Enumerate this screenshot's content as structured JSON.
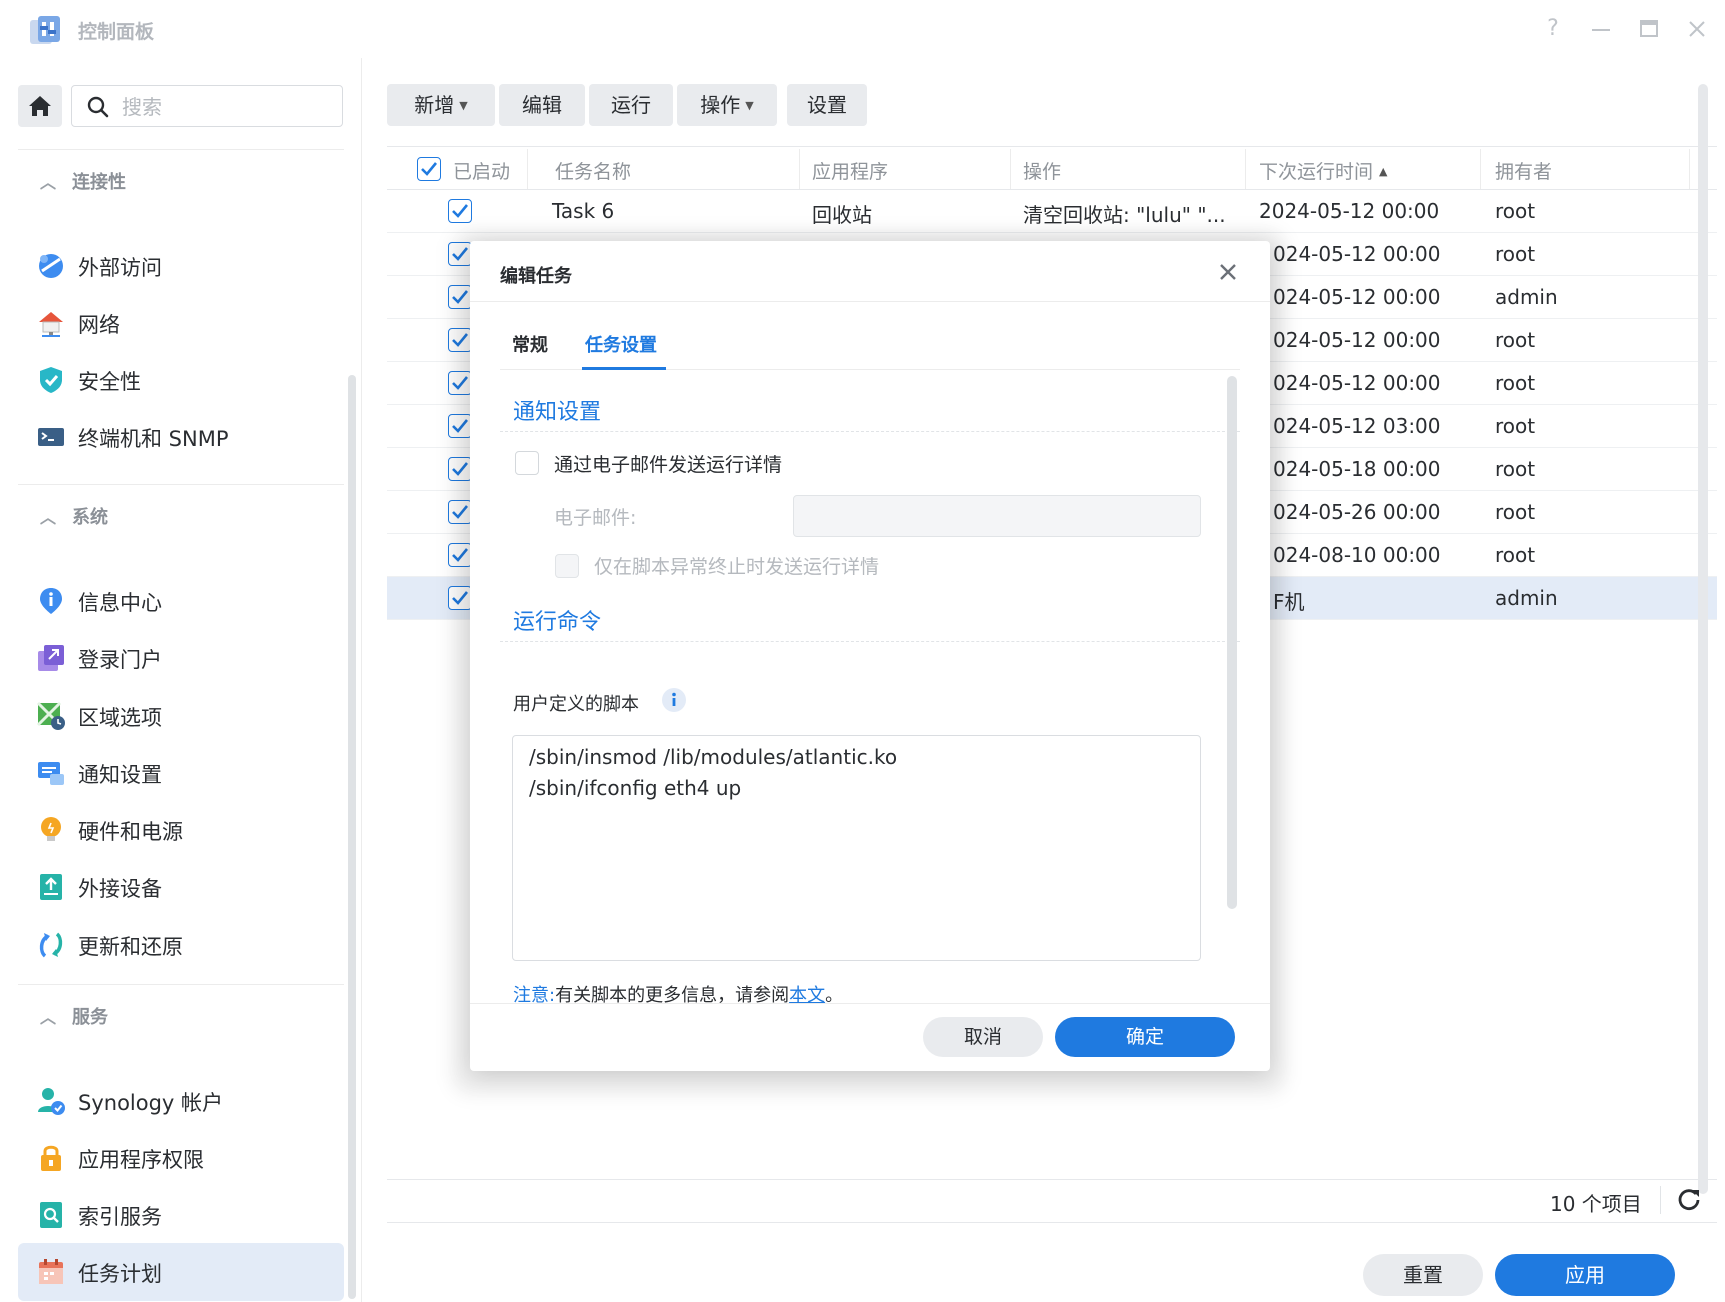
{
  "window": {
    "title": "控制面板"
  },
  "sidebar": {
    "search_placeholder": "搜索",
    "groups": [
      {
        "label": "连接性",
        "items": [
          "外部访问",
          "网络",
          "安全性",
          "终端机和 SNMP"
        ]
      },
      {
        "label": "系统",
        "items": [
          "信息中心",
          "登录门户",
          "区域选项",
          "通知设置",
          "硬件和电源",
          "外接设备",
          "更新和还原"
        ]
      },
      {
        "label": "服务",
        "items": [
          "Synology 帐户",
          "应用程序权限",
          "索引服务",
          "任务计划"
        ]
      }
    ],
    "active_item": "任务计划"
  },
  "toolbar": {
    "add": "新增",
    "edit": "编辑",
    "run": "运行",
    "action": "操作",
    "settings": "设置"
  },
  "grid": {
    "columns": [
      "已启动",
      "任务名称",
      "应用程序",
      "操作",
      "下次运行时间",
      "拥有者"
    ],
    "rows": [
      {
        "name": "Task 6",
        "app": "回收站",
        "action": "清空回收站: \"lulu\" \"...",
        "next": "2024-05-12 00:00",
        "owner": "root"
      },
      {
        "next": "024-05-12 00:00",
        "owner": "root"
      },
      {
        "next": "024-05-12 00:00",
        "owner": "admin"
      },
      {
        "next": "024-05-12 00:00",
        "owner": "root"
      },
      {
        "next": "024-05-12 00:00",
        "owner": "root"
      },
      {
        "next": "024-05-12 03:00",
        "owner": "root"
      },
      {
        "next": "024-05-18 00:00",
        "owner": "root"
      },
      {
        "next": "024-05-26 00:00",
        "owner": "root"
      },
      {
        "next": "024-08-10 00:00",
        "owner": "root"
      },
      {
        "next": "F机",
        "owner": "admin"
      }
    ],
    "count": "10 个项目"
  },
  "footer": {
    "reset": "重置",
    "apply": "应用"
  },
  "dialog": {
    "title": "编辑任务",
    "tabs": [
      "常规",
      "任务设置"
    ],
    "active_tab": "任务设置",
    "notify_section": "通知设置",
    "email_checkbox": "通过电子邮件发送运行详情",
    "email_label": "电子邮件:",
    "email_value": "",
    "only_abnormal": "仅在脚本异常终止时发送运行详情",
    "command_section": "运行命令",
    "script_label": "用户定义的脚本",
    "script": "/sbin/insmod /lib/modules/atlantic.ko\n/sbin/ifconfig eth4 up",
    "note_label": "注意:",
    "note_text": "有关脚本的更多信息，请参阅",
    "note_link": "本文",
    "note_end": "。",
    "cancel": "取消",
    "ok": "确定"
  },
  "colors": {
    "accent": "#1f7ae0",
    "selected_row": "#e3ebf7"
  }
}
